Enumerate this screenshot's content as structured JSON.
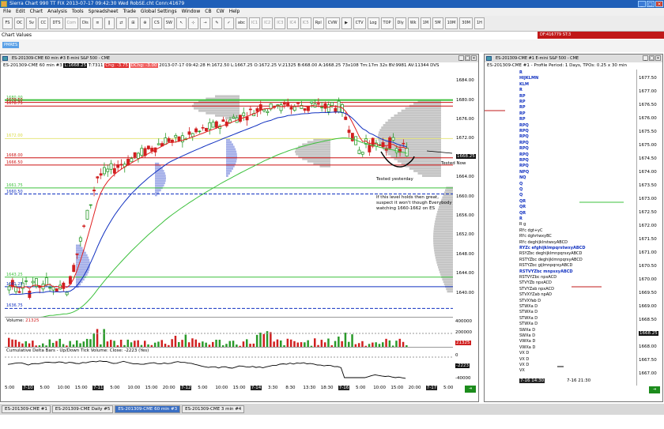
{
  "app": {
    "title": "Sierra Chart 990 TT FIX 2013-07-17  09:42:30 Wed   RobSE.cht Conn:41679"
  },
  "menu": [
    "File",
    "Edit",
    "Chart",
    "Analysis",
    "Tools",
    "Spreadsheet",
    "Trade",
    "Global Settings",
    "Window",
    "CB",
    "CW",
    "Help"
  ],
  "toolbar": {
    "buttons": [
      "FS",
      "OC",
      "Sv",
      "CC",
      "DTS",
      "Com",
      "Dis",
      "≡",
      "‖",
      "⇄",
      "⊞",
      "⊕",
      "CS",
      "SW",
      "↖",
      "⊹",
      "→",
      "✎",
      "✓",
      "abc",
      "IC1",
      "IC2",
      "IC3",
      "IC4",
      "IC5",
      "Rpl",
      "CVW",
      "▶",
      "CTV",
      "Log",
      "TOP",
      "Dly",
      "Wk",
      "1M",
      "5M",
      "10M",
      "30M",
      "1H"
    ]
  },
  "chart_values": {
    "label": "Chart Values",
    "df_label": "DF:416779   ST:3",
    "pm_label": "PMRES"
  },
  "main": {
    "window_title": "ES-201309-CME  60 min  #3  E-mini S&P 500 - CME",
    "stats": {
      "symbol": "ES-201309-CME  60 min  #3",
      "last": "L:1668.25",
      "t": "T:7311",
      "chg": "Chg: -3.75",
      "dchg": "DChg: -3.00",
      "rest": "2013-07-17 09:42:28  H:1672.50  L:1667.25  O:1672.25  V:21325  B:668.00  A:1668.25  73x108  Tm:17m 32s  BV:9981  AV:11344  DVS"
    },
    "price_ticks": [
      "1684.00",
      "1680.00",
      "1676.00",
      "1672.00",
      "1668.00",
      "1664.00",
      "1660.00",
      "1656.00",
      "1652.00",
      "1648.00",
      "1644.00",
      "1640.00"
    ],
    "current_price": "1668.25",
    "levels": [
      {
        "label": "1680.00",
        "color": "#3cc03c"
      },
      {
        "label": "1679.50",
        "color": "#cc1010"
      },
      {
        "label": "1678.75",
        "color": "#cc1010"
      },
      {
        "label": "1672.00",
        "color": "#d8d840"
      },
      {
        "label": "1668.00",
        "color": "#cc1010"
      },
      {
        "label": "1666.50",
        "color": "#cc1010"
      },
      {
        "label": "1661.75",
        "color": "#3cc03c"
      },
      {
        "label": "1660.50",
        "color": "#1030c0"
      },
      {
        "label": "1643.25",
        "color": "#3cc03c"
      },
      {
        "label": "1641.25",
        "color": "#1030c0"
      },
      {
        "label": "1636.75",
        "color": "#1030c0"
      }
    ],
    "annotations": {
      "tested_now": "Tested Now",
      "tested_yesterday": "Tested yesterday",
      "note": "If this level holds then great, suspect it won't though Everybody watching 1660-1662 on ES"
    },
    "volume": {
      "label": "Volume:",
      "value": "21325",
      "ticks": [
        "400000",
        "200000"
      ],
      "current": "21325"
    },
    "cumdelta": {
      "label": "Cumulative Delta Bars - Up/Down Tick Volume:  Close: -2223  (Yes)",
      "ticks": [
        "0",
        "-2223",
        "-40000"
      ]
    },
    "x_axis": [
      {
        "t": "5:00"
      },
      {
        "t": "7-10",
        "b": true
      },
      {
        "t": "5:00"
      },
      {
        "t": "10:00"
      },
      {
        "t": "15:00"
      },
      {
        "t": "7-11",
        "b": true
      },
      {
        "t": "5:00"
      },
      {
        "t": "10:00"
      },
      {
        "t": "15:00"
      },
      {
        "t": "20:00"
      },
      {
        "t": "7-12",
        "b": true
      },
      {
        "t": "5:00"
      },
      {
        "t": "10:00"
      },
      {
        "t": "15:00"
      },
      {
        "t": "7-14",
        "b": true
      },
      {
        "t": "3:30"
      },
      {
        "t": "8:30"
      },
      {
        "t": "13:30"
      },
      {
        "t": "18:30"
      },
      {
        "t": "7-16",
        "b": true
      },
      {
        "t": "5:00"
      },
      {
        "t": "10:00"
      },
      {
        "t": "15:00"
      },
      {
        "t": "20:00"
      },
      {
        "t": "7-17",
        "b": true
      },
      {
        "t": "5:00"
      }
    ]
  },
  "right": {
    "window_title": "ES-201309-CME  #1  E-mini S&P 500 - CME",
    "stats": "ES-201309-CME  #1 - Profile Period: 1 Days, TPOs: 0.25 x 30 min",
    "ticks": [
      "1677.50",
      "1677.00",
      "1676.50",
      "1676.00",
      "1675.50",
      "1675.00",
      "1674.50",
      "1674.00",
      "1673.50",
      "1673.00",
      "1672.50",
      "1672.00",
      "1671.50",
      "1671.00",
      "1670.50",
      "1670.00",
      "1669.50",
      "1669.00",
      "1668.50",
      "1668.25",
      "1668.00",
      "1667.50",
      "1667.00"
    ],
    "current": "1668.25",
    "x_axis": [
      "7-16  14:30",
      "7-16  21:30"
    ],
    "tpo_rows": [
      {
        "t": "R",
        "c": "bl"
      },
      {
        "t": "HIJKLMN",
        "c": "bl"
      },
      {
        "t": "KLM",
        "c": "bl"
      },
      {
        "t": "R",
        "c": "bl"
      },
      {
        "t": "RP",
        "c": "bl"
      },
      {
        "t": "RP",
        "c": "bl"
      },
      {
        "t": "RP",
        "c": "bl"
      },
      {
        "t": "RP",
        "c": "bl"
      },
      {
        "t": "RP",
        "c": "bl"
      },
      {
        "t": "RPQ",
        "c": "bl"
      },
      {
        "t": "RPQ",
        "c": "bl"
      },
      {
        "t": "RPQ",
        "c": "bl"
      },
      {
        "t": "RPQ",
        "c": "bl"
      },
      {
        "t": "RPQ",
        "c": "bl"
      },
      {
        "t": "RPQ",
        "c": "bl"
      },
      {
        "t": "RPQ",
        "c": "bl"
      },
      {
        "t": "RPQ",
        "c": "bl"
      },
      {
        "t": "NPQ",
        "c": "bl"
      },
      {
        "t": "NQ",
        "c": "bl"
      },
      {
        "t": "Q",
        "c": "bl"
      },
      {
        "t": "Q",
        "c": "bl"
      },
      {
        "t": "Q",
        "c": "bl"
      },
      {
        "t": "QR",
        "c": "bl"
      },
      {
        "t": "QR",
        "c": "bl"
      },
      {
        "t": "QR",
        "c": "bl"
      },
      {
        "t": "R",
        "c": "bl"
      },
      {
        "t": "R      g",
        "c": "bk"
      },
      {
        "t": "RYc     dgt+yC",
        "c": "bk"
      },
      {
        "t": "RYc     dghrtwxyBC",
        "c": "bk"
      },
      {
        "t": "RYc     deghijklrstwxyABCD",
        "c": "bk"
      },
      {
        "t": "RYZc   efghijklmpqrstwxyABCD",
        "c": "bl"
      },
      {
        "t": "RSYZbc  deghijklmnpqrsxyABCD",
        "c": "bk"
      },
      {
        "t": "RSTYZbc  deghijklmnpqrxyABCD",
        "c": "bk"
      },
      {
        "t": "RSTYZbc  gijlmnpqrxyABCD",
        "c": "bk"
      },
      {
        "t": "RSTVYZbc  mnpsxyABCD",
        "c": "bl"
      },
      {
        "t": "RSTVYZbc  npxACD",
        "c": "bk"
      },
      {
        "t": "STVYZb   npxACD",
        "c": "bk"
      },
      {
        "t": "STVYZab  npxACD",
        "c": "bk"
      },
      {
        "t": "STVXYZab  npAD",
        "c": "bk"
      },
      {
        "t": "STVXYab   D",
        "c": "bk"
      },
      {
        "t": "STWXa     D",
        "c": "bk"
      },
      {
        "t": "STWXa     D",
        "c": "bk"
      },
      {
        "t": "STWXa     D",
        "c": "bk"
      },
      {
        "t": "STWXa     D",
        "c": "bk"
      },
      {
        "t": "SWXa      D",
        "c": "bk"
      },
      {
        "t": "SWXa      D",
        "c": "bk"
      },
      {
        "t": "VWXa      D",
        "c": "bk"
      },
      {
        "t": "VWXa      D",
        "c": "bk"
      },
      {
        "t": "VX        D",
        "c": "bk"
      },
      {
        "t": "VX        D",
        "c": "bk"
      },
      {
        "t": "VX        D",
        "c": "bk"
      },
      {
        "t": "VX",
        "c": "bk"
      }
    ]
  },
  "tabs": [
    "ES-201309-CME  #1",
    "ES-201309-CME  Daily  #5",
    "ES-201309-CME  60 min  #3",
    "ES-201309-CME  3 min  #4"
  ],
  "active_tab": 2,
  "colors": {
    "up": "#2a9a2a",
    "down": "#d02020",
    "ma_red": "#e02020",
    "ma_blue": "#1030c0",
    "ma_green": "#3cc03c",
    "profile": "#bbbbbb",
    "profile_blue": "#8090e0"
  }
}
